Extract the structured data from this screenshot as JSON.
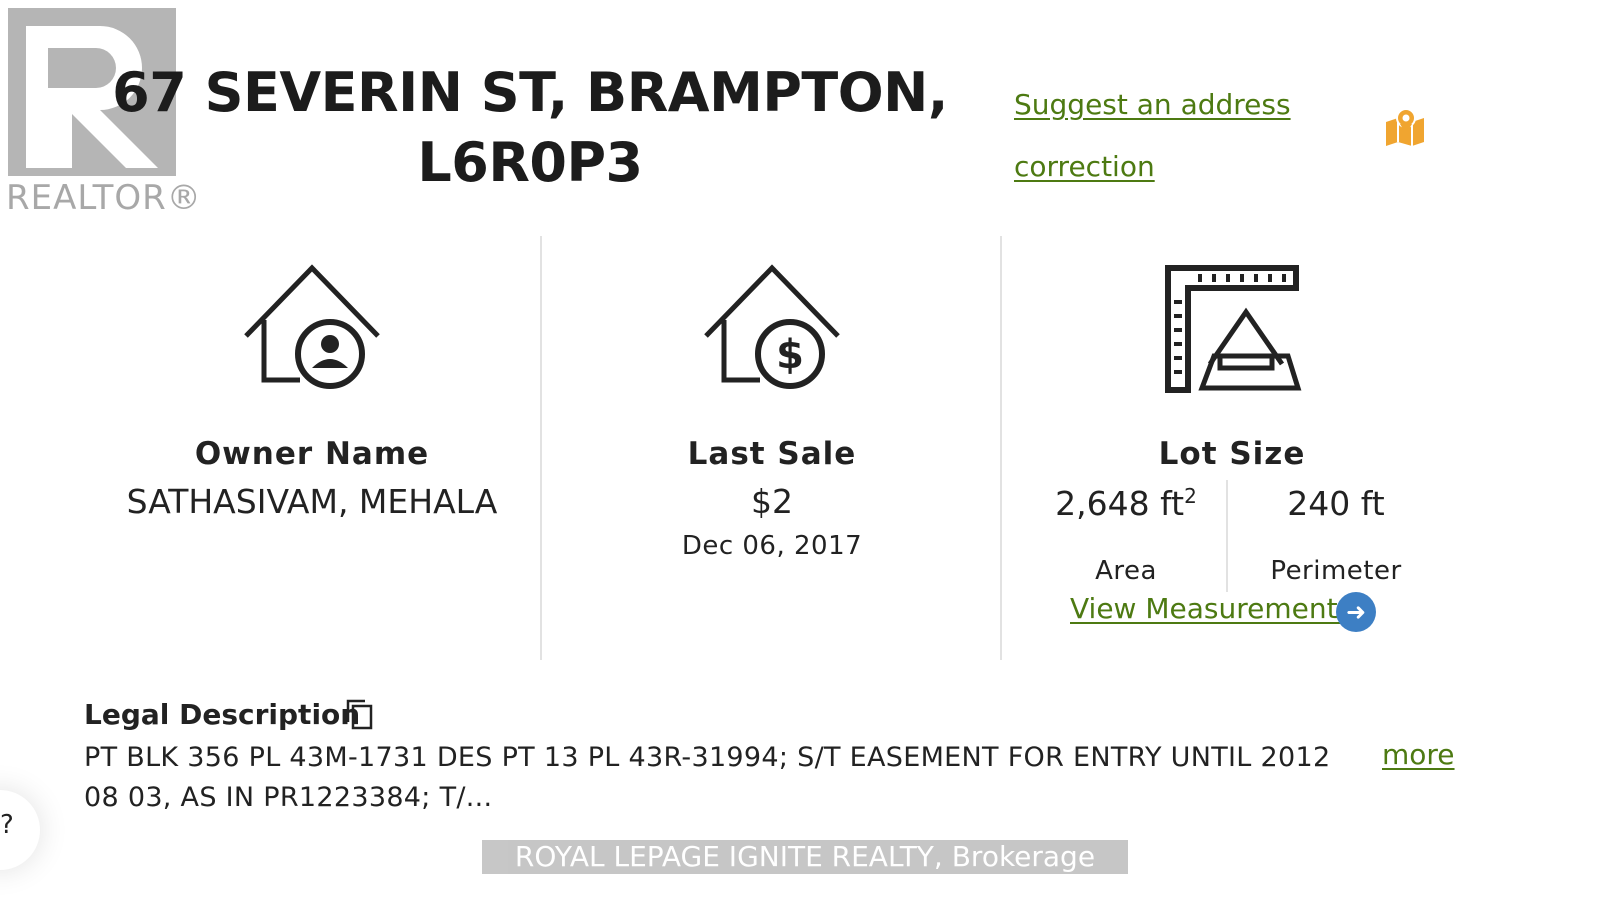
{
  "logo": {
    "wordmark": "REALTOR®"
  },
  "header": {
    "address_line1": "67 SEVERIN ST, BRAMPTON,",
    "address_line2": "L6R0P3",
    "suggest_line1": "Suggest an address",
    "suggest_line2": "correction",
    "map_icon": "map-pin-icon",
    "accent_color": "#4d7a12",
    "map_icon_color": "#f0a530"
  },
  "cards": {
    "owner": {
      "label": "Owner Name",
      "value": "SATHASIVAM, MEHALA",
      "icon": "house-person-icon"
    },
    "sale": {
      "label": "Last Sale",
      "value": "$2",
      "date": "Dec 06, 2017",
      "icon": "house-dollar-icon"
    },
    "lot": {
      "label": "Lot Size",
      "area_value": "2,648 ft",
      "area_sup": "2",
      "area_label": "Area",
      "perimeter_value": "240 ft",
      "perimeter_label": "Perimeter",
      "link": "View Measurements",
      "icon": "lot-measure-icon",
      "arrow_icon": "arrow-right-icon",
      "arrow_color": "#3d7fc4"
    }
  },
  "legal": {
    "heading": "Legal Description",
    "text": "PT BLK 356 PL 43M-1731 DES PT 13 PL 43R-31994; S/T EASEMENT FOR ENTRY UNTIL 2012 08 03, AS IN PR1223384; T/...",
    "more": "more",
    "copy_icon": "copy-icon"
  },
  "footer": {
    "brokerage": "ROYAL LEPAGE IGNITE REALTY, Brokerage"
  },
  "side": {
    "help_glyph": "?"
  }
}
